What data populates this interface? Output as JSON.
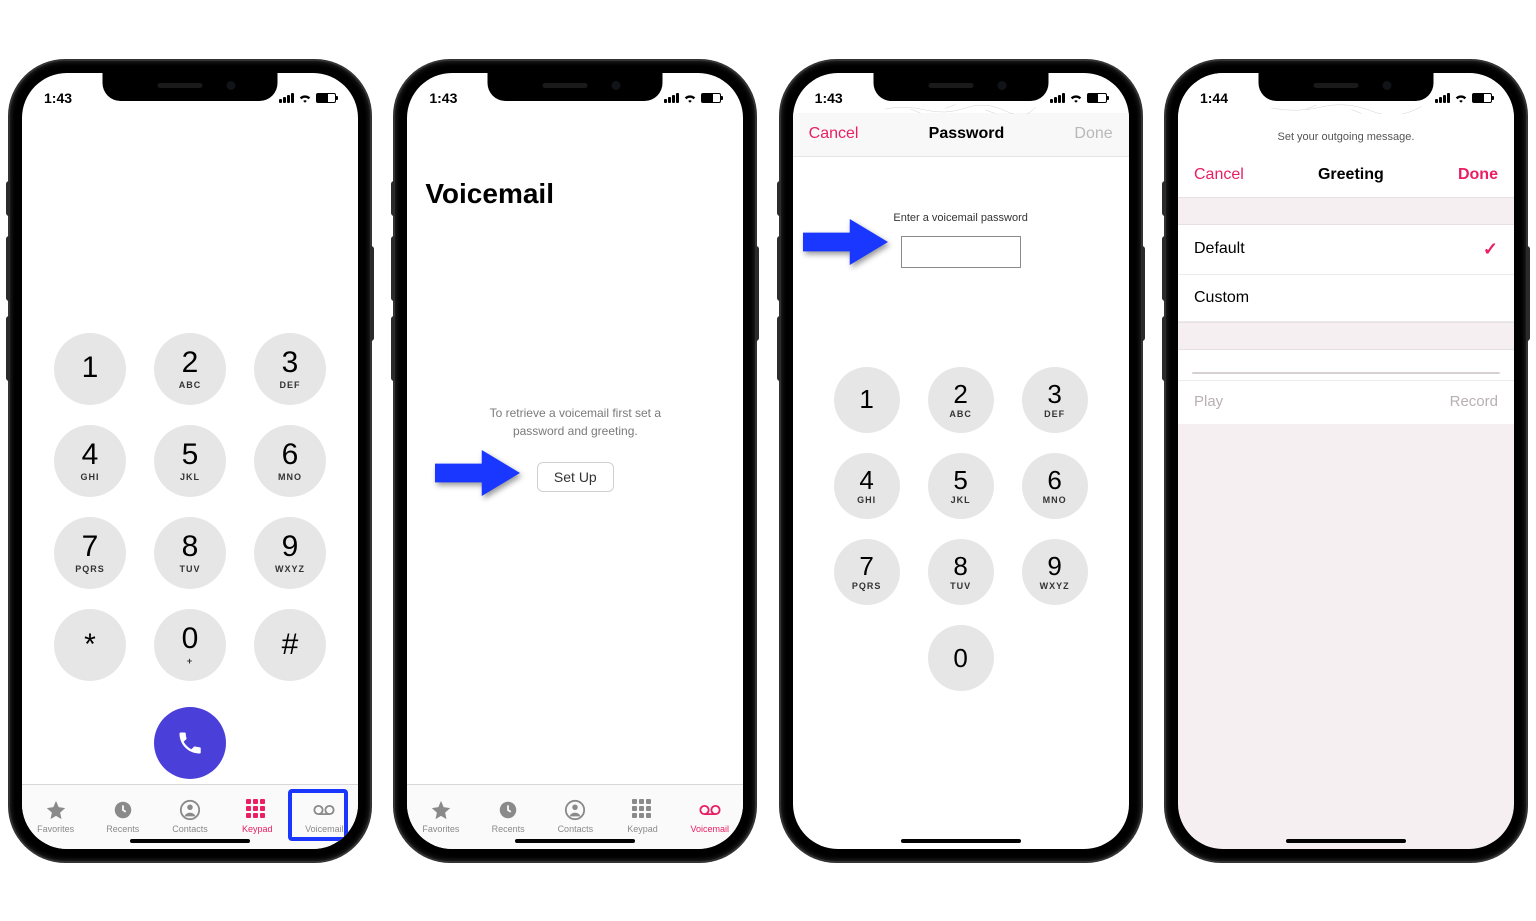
{
  "status": {
    "time1": "1:43",
    "time2": "1:43",
    "time3": "1:43",
    "time4": "1:44"
  },
  "keypad": [
    {
      "num": "1",
      "sub": ""
    },
    {
      "num": "2",
      "sub": "ABC"
    },
    {
      "num": "3",
      "sub": "DEF"
    },
    {
      "num": "4",
      "sub": "GHI"
    },
    {
      "num": "5",
      "sub": "JKL"
    },
    {
      "num": "6",
      "sub": "MNO"
    },
    {
      "num": "7",
      "sub": "PQRS"
    },
    {
      "num": "8",
      "sub": "TUV"
    },
    {
      "num": "9",
      "sub": "WXYZ"
    },
    {
      "num": "*",
      "sub": ""
    },
    {
      "num": "0",
      "sub": "+"
    },
    {
      "num": "#",
      "sub": ""
    }
  ],
  "tabs": [
    "Favorites",
    "Recents",
    "Contacts",
    "Keypad",
    "Voicemail"
  ],
  "screen2": {
    "title": "Voicemail",
    "msg1": "To retrieve a voicemail first set a",
    "msg2": "password and greeting.",
    "button": "Set Up"
  },
  "screen3": {
    "cancel": "Cancel",
    "title": "Password",
    "done": "Done",
    "prompt": "Enter a voicemail password"
  },
  "screen4": {
    "subtitle": "Set your outgoing message.",
    "cancel": "Cancel",
    "title": "Greeting",
    "done": "Done",
    "option1": "Default",
    "option2": "Custom",
    "play": "Play",
    "record": "Record"
  }
}
